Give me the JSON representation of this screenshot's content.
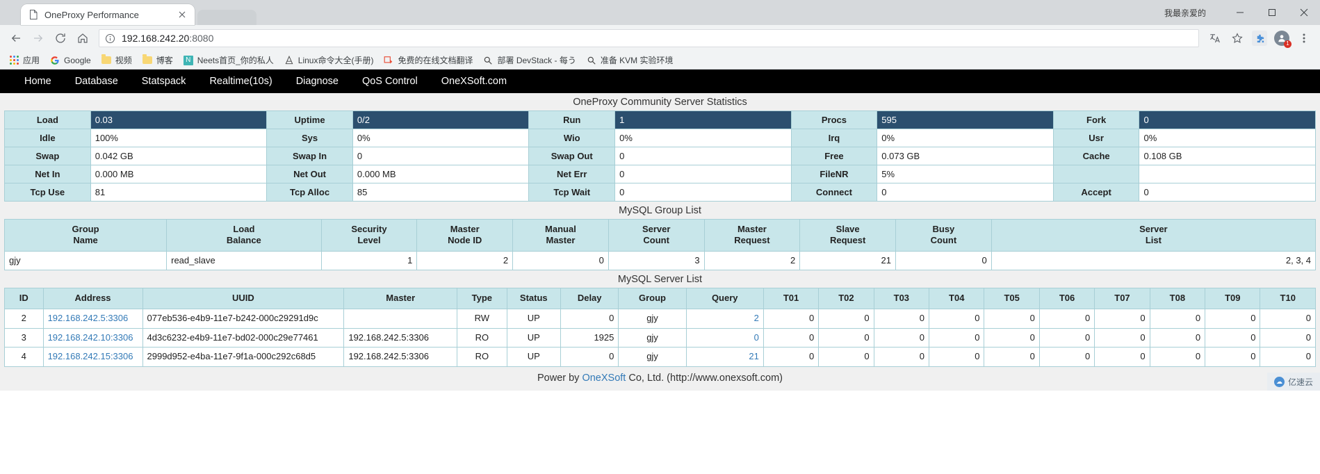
{
  "browser": {
    "tab": {
      "title": "OneProxy Performance",
      "favicon_icon": "page-icon",
      "close_icon": "close-icon"
    },
    "window": {
      "user_label": "我最亲爱的",
      "minimize_icon": "minimize-icon",
      "maximize_icon": "maximize-icon",
      "close_icon": "window-close-icon"
    },
    "toolbar": {
      "back_icon": "back-arrow-icon",
      "forward_icon": "forward-arrow-icon",
      "reload_icon": "reload-icon",
      "home_icon": "home-icon",
      "translate_icon": "translate-icon",
      "bookmark_star_icon": "star-icon",
      "extension_icon": "puzzle-extension-icon",
      "profile_icon": "profile-avatar-icon",
      "menu_icon": "three-dot-menu-icon",
      "extension_badge": "1"
    },
    "omnibox": {
      "info_icon": "info-circle-icon",
      "host": "192.168.242.20",
      "port": ":8080"
    },
    "bookmarks": [
      {
        "label": "应用",
        "icon": "apps-grid-icon"
      },
      {
        "label": "Google",
        "icon": "google-g-icon"
      },
      {
        "label": "视频",
        "icon": "folder-icon"
      },
      {
        "label": "博客",
        "icon": "folder-icon"
      },
      {
        "label": "Neets首页_你的私人",
        "icon": "neets-n-icon"
      },
      {
        "label": "Linux命令大全(手册)",
        "icon": "linux-site-icon"
      },
      {
        "label": "免费的在线文档翻译",
        "icon": "translate-site-icon"
      },
      {
        "label": "部署 DevStack - 每う",
        "icon": "search-site-icon"
      },
      {
        "label": "准备 KVM 实验环境",
        "icon": "search-site-icon"
      }
    ]
  },
  "nav": {
    "items": [
      {
        "label": "Home"
      },
      {
        "label": "Database"
      },
      {
        "label": "Statspack"
      },
      {
        "label": "Realtime(10s)"
      },
      {
        "label": "Diagnose"
      },
      {
        "label": "QoS Control"
      },
      {
        "label": "OneXSoft.com"
      }
    ]
  },
  "stats": {
    "title": "OneProxy Community Server Statistics",
    "rows": [
      [
        {
          "label": "Load",
          "value": "0.03",
          "highlight": true
        },
        {
          "label": "Uptime",
          "value": "0/2",
          "highlight": true
        },
        {
          "label": "Run",
          "value": "1",
          "highlight": true
        },
        {
          "label": "Procs",
          "value": "595",
          "highlight": true
        },
        {
          "label": "Fork",
          "value": "0",
          "highlight": true
        }
      ],
      [
        {
          "label": "Idle",
          "value": "100%",
          "highlight": false
        },
        {
          "label": "Sys",
          "value": "0%",
          "highlight": false
        },
        {
          "label": "Wio",
          "value": "0%",
          "highlight": false
        },
        {
          "label": "Irq",
          "value": "0%",
          "highlight": false
        },
        {
          "label": "Usr",
          "value": "0%",
          "highlight": false
        }
      ],
      [
        {
          "label": "Swap",
          "value": "0.042 GB",
          "highlight": false
        },
        {
          "label": "Swap In",
          "value": "0",
          "highlight": false
        },
        {
          "label": "Swap Out",
          "value": "0",
          "highlight": false
        },
        {
          "label": "Free",
          "value": "0.073 GB",
          "highlight": false
        },
        {
          "label": "Cache",
          "value": "0.108 GB",
          "highlight": false
        }
      ],
      [
        {
          "label": "Net In",
          "value": "0.000 MB",
          "highlight": false
        },
        {
          "label": "Net Out",
          "value": "0.000 MB",
          "highlight": false
        },
        {
          "label": "Net Err",
          "value": "0",
          "highlight": false
        },
        {
          "label": "FileNR",
          "value": "5%",
          "highlight": false
        },
        {
          "label": "",
          "value": "",
          "highlight": false
        }
      ],
      [
        {
          "label": "Tcp Use",
          "value": "81",
          "highlight": false
        },
        {
          "label": "Tcp Alloc",
          "value": "85",
          "highlight": false
        },
        {
          "label": "Tcp Wait",
          "value": "0",
          "highlight": false
        },
        {
          "label": "Connect",
          "value": "0",
          "highlight": false
        },
        {
          "label": "Accept",
          "value": "0",
          "highlight": false
        }
      ]
    ]
  },
  "group_list": {
    "title": "MySQL Group List",
    "headers": [
      "Group\nName",
      "Load\nBalance",
      "Security\nLevel",
      "Master\nNode ID",
      "Manual\nMaster",
      "Server\nCount",
      "Master\nRequest",
      "Slave\nRequest",
      "Busy\nCount",
      "Server\nList"
    ],
    "rows": [
      {
        "group_name": "gjy",
        "load_balance": "read_slave",
        "security_level": "1",
        "master_node_id": "2",
        "manual_master": "0",
        "server_count": "3",
        "master_request": "2",
        "slave_request": "21",
        "busy_count": "0",
        "server_list": "2, 3, 4"
      }
    ]
  },
  "server_list": {
    "title": "MySQL Server List",
    "headers": [
      "ID",
      "Address",
      "UUID",
      "Master",
      "Type",
      "Status",
      "Delay",
      "Group",
      "Query",
      "T01",
      "T02",
      "T03",
      "T04",
      "T05",
      "T06",
      "T07",
      "T08",
      "T09",
      "T10"
    ],
    "rows": [
      {
        "id": "2",
        "address": "192.168.242.5:3306",
        "uuid": "077eb536-e4b9-11e7-b242-000c29291d9c",
        "master": "",
        "type": "RW",
        "status": "UP",
        "delay": "0",
        "group": "gjy",
        "query": "2",
        "timers": [
          "0",
          "0",
          "0",
          "0",
          "0",
          "0",
          "0",
          "0",
          "0",
          "0"
        ]
      },
      {
        "id": "3",
        "address": "192.168.242.10:3306",
        "uuid": "4d3c6232-e4b9-11e7-bd02-000c29e77461",
        "master": "192.168.242.5:3306",
        "type": "RO",
        "status": "UP",
        "delay": "1925",
        "group": "gjy",
        "query": "0",
        "timers": [
          "0",
          "0",
          "0",
          "0",
          "0",
          "0",
          "0",
          "0",
          "0",
          "0"
        ]
      },
      {
        "id": "4",
        "address": "192.168.242.15:3306",
        "uuid": "2999d952-e4ba-11e7-9f1a-000c292c68d5",
        "master": "192.168.242.5:3306",
        "type": "RO",
        "status": "UP",
        "delay": "0",
        "group": "gjy",
        "query": "21",
        "timers": [
          "0",
          "0",
          "0",
          "0",
          "0",
          "0",
          "0",
          "0",
          "0",
          "0"
        ]
      }
    ]
  },
  "footer": {
    "prefix": "Power by ",
    "link": "OneXSoft",
    "suffix": " Co, Ltd. (http://www.onexsoft.com)"
  },
  "watermark": {
    "label": "亿速云"
  },
  "colors": {
    "header_bg": "#c8e6ea",
    "border": "#a8cfd6",
    "highlight_bg": "#2b4f6e",
    "link": "#337ab7",
    "nav_bg": "#000000"
  }
}
